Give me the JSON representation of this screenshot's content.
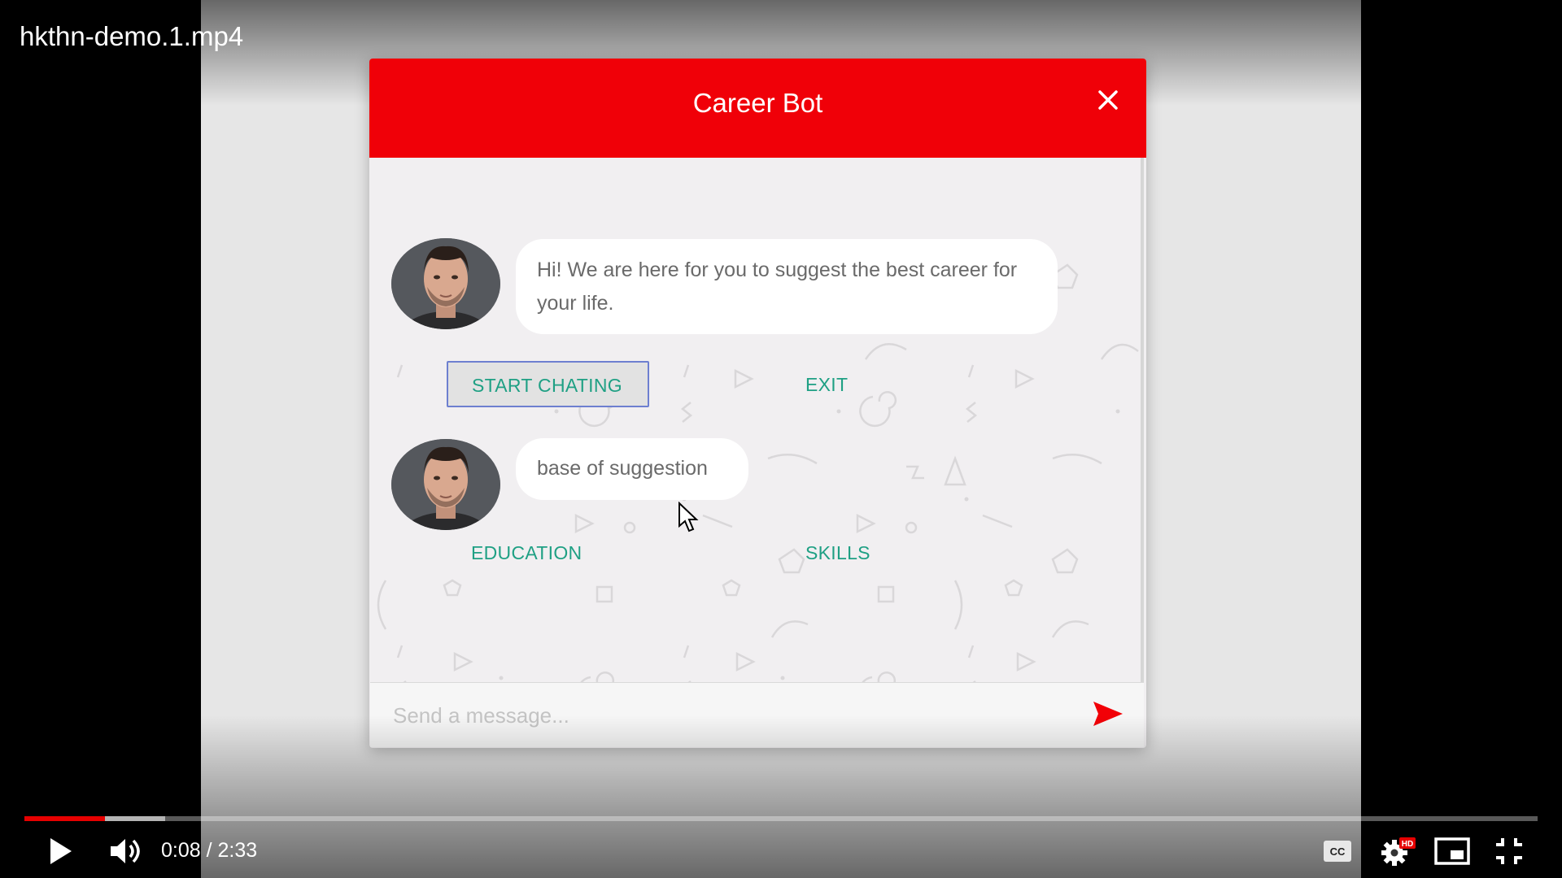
{
  "video": {
    "title": "hkthn-demo.1.mp4",
    "time_current": "0:08",
    "time_separator": " / ",
    "time_total": "2:33",
    "progress_played_fraction": 0.053,
    "progress_buffered_fraction": 0.093,
    "quality_badge": "HD",
    "accent_color": "#e60000"
  },
  "chat": {
    "title": "Career Bot",
    "header_color": "#f00008",
    "messages": [
      {
        "text": "Hi! We are here for you to suggest the best career for your life."
      },
      {
        "text": "base of suggestion"
      }
    ],
    "options_1": {
      "start": "START CHATING",
      "exit": "EXIT"
    },
    "options_2": {
      "education": "EDUCATION",
      "skills": "SKILLS"
    },
    "input_placeholder": "Send a message...",
    "option_color": "#1fa084"
  },
  "icons": {
    "close": "close-icon",
    "send": "send-icon",
    "play": "play-icon",
    "volume": "volume-icon",
    "captions": "captions-icon",
    "settings": "settings-icon",
    "miniplayer": "miniplayer-icon",
    "exit_fullscreen": "exit-fullscreen-icon"
  }
}
